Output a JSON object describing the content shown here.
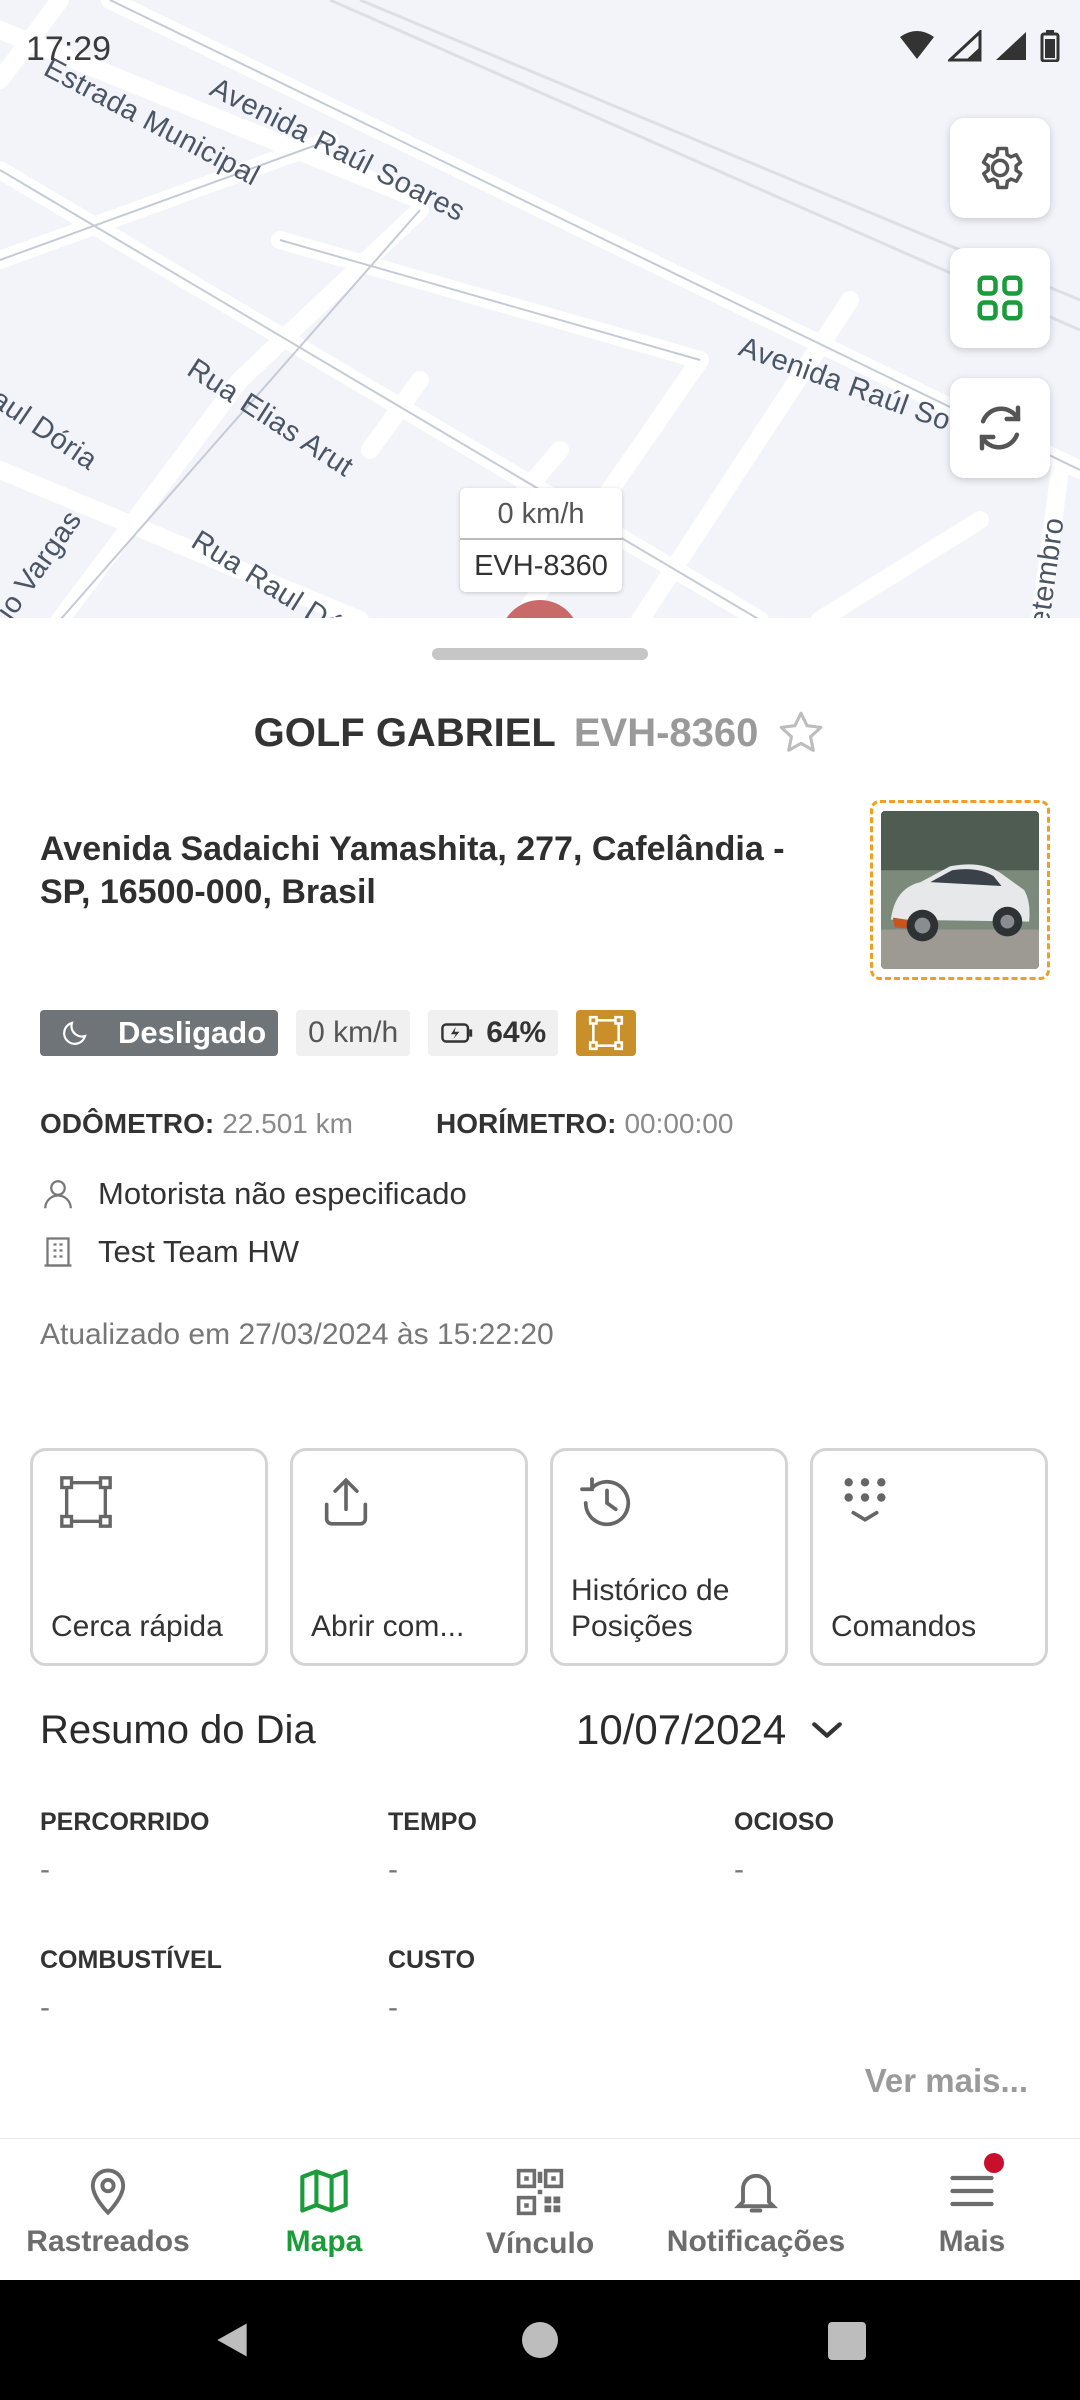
{
  "status_bar": {
    "time": "17:29"
  },
  "map": {
    "streets": [
      "Estrada Municipal",
      "Avenida Raúl Soares",
      "Avenida Raúl So",
      "Rua Elias Arut",
      "aul Dória",
      "io Vargas",
      "Rua Raul Dó",
      "etembro"
    ],
    "vehicle_speed": "0 km/h",
    "vehicle_plate": "EVH-8360",
    "buttons": [
      "gear-icon",
      "grid-icon",
      "refresh-icon"
    ]
  },
  "vehicle": {
    "name": "GOLF GABRIEL",
    "plate": "EVH-8360",
    "address": "Avenida Sadaichi Yamashita, 277, Cafelândia - SP, 16500-000, Brasil",
    "status": "Desligado",
    "speed": "0 km/h",
    "battery": "64%",
    "odometer_label": "ODÔMETRO:",
    "odometer_value": "22.501 km",
    "hourmeter_label": "HORÍMETRO:",
    "hourmeter_value": "00:00:00",
    "driver": "Motorista não especificado",
    "team": "Test Team HW",
    "updated": "Atualizado em 27/03/2024 às 15:22:20"
  },
  "actions": [
    {
      "label": "Cerca rápida",
      "icon": "fence-icon"
    },
    {
      "label": "Abrir com...",
      "icon": "share-icon"
    },
    {
      "label": "Histórico de Posições",
      "icon": "history-icon"
    },
    {
      "label": "Comandos",
      "icon": "keypad-icon"
    }
  ],
  "summary": {
    "title": "Resumo do Dia",
    "date": "10/07/2024",
    "items": [
      {
        "label": "PERCORRIDO",
        "value": "-"
      },
      {
        "label": "TEMPO",
        "value": "-"
      },
      {
        "label": "OCIOSO",
        "value": "-"
      },
      {
        "label": "COMBUSTÍVEL",
        "value": "-"
      },
      {
        "label": "CUSTO",
        "value": "-"
      }
    ],
    "see_more": "Ver mais..."
  },
  "bottom_nav": [
    {
      "label": "Rastreados",
      "icon": "location-pin-icon"
    },
    {
      "label": "Mapa",
      "icon": "map-icon",
      "active": true
    },
    {
      "label": "Vínculo",
      "icon": "qr-code-icon"
    },
    {
      "label": "Notificações",
      "icon": "bell-icon"
    },
    {
      "label": "Mais",
      "icon": "menu-icon",
      "badge": true
    }
  ],
  "colors": {
    "accent_green": "#1a9c3a",
    "status_off": "#6f7478",
    "fence_chip": "#c9902a",
    "photo_border": "#f0a020",
    "badge_red": "#c8102e"
  }
}
